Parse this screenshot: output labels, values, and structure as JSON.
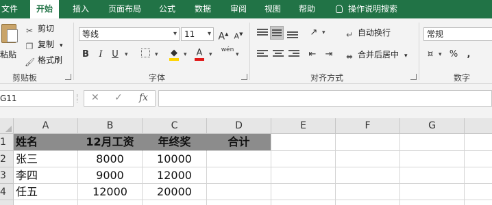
{
  "ribbon_tabs": [
    "文件",
    "开始",
    "插入",
    "页面布局",
    "公式",
    "数据",
    "审阅",
    "视图",
    "帮助"
  ],
  "active_tab": "开始",
  "tell_me": "操作说明搜索",
  "clipboard": {
    "paste": "粘贴",
    "cut": "剪切",
    "copy": "复制",
    "format_painter": "格式刷",
    "group_label": "剪贴板"
  },
  "font": {
    "name": "等线",
    "size": "11",
    "bold": "B",
    "italic": "I",
    "underline": "U",
    "grow": "A",
    "shrink": "A",
    "phonetic": "wén",
    "group_label": "字体"
  },
  "alignment": {
    "wrap_text": "自动换行",
    "merge_center": "合并后居中",
    "group_label": "对齐方式"
  },
  "number": {
    "format": "常规",
    "percent": "%",
    "comma": ",",
    "group_label": "数字"
  },
  "formula_bar": {
    "name_box": "G11",
    "cancel": "✕",
    "enter": "✓",
    "fx": "fx",
    "content": ""
  },
  "sheet": {
    "columns": [
      "A",
      "B",
      "C",
      "D",
      "E",
      "F",
      "G"
    ],
    "rows": [
      "1",
      "2",
      "3",
      "4"
    ],
    "header_row": [
      "姓名",
      "12月工资",
      "年终奖",
      "合计"
    ],
    "data_rows": [
      [
        "张三",
        "8000",
        "10000",
        ""
      ],
      [
        "李四",
        "9000",
        "12000",
        ""
      ],
      [
        "任五",
        "12000",
        "20000",
        ""
      ]
    ]
  },
  "colors": {
    "ribbon_green": "#217346",
    "header_fill": "#8c8c8c",
    "font_color_bar": "#e01818",
    "fill_color_bar": "#ffd400"
  }
}
